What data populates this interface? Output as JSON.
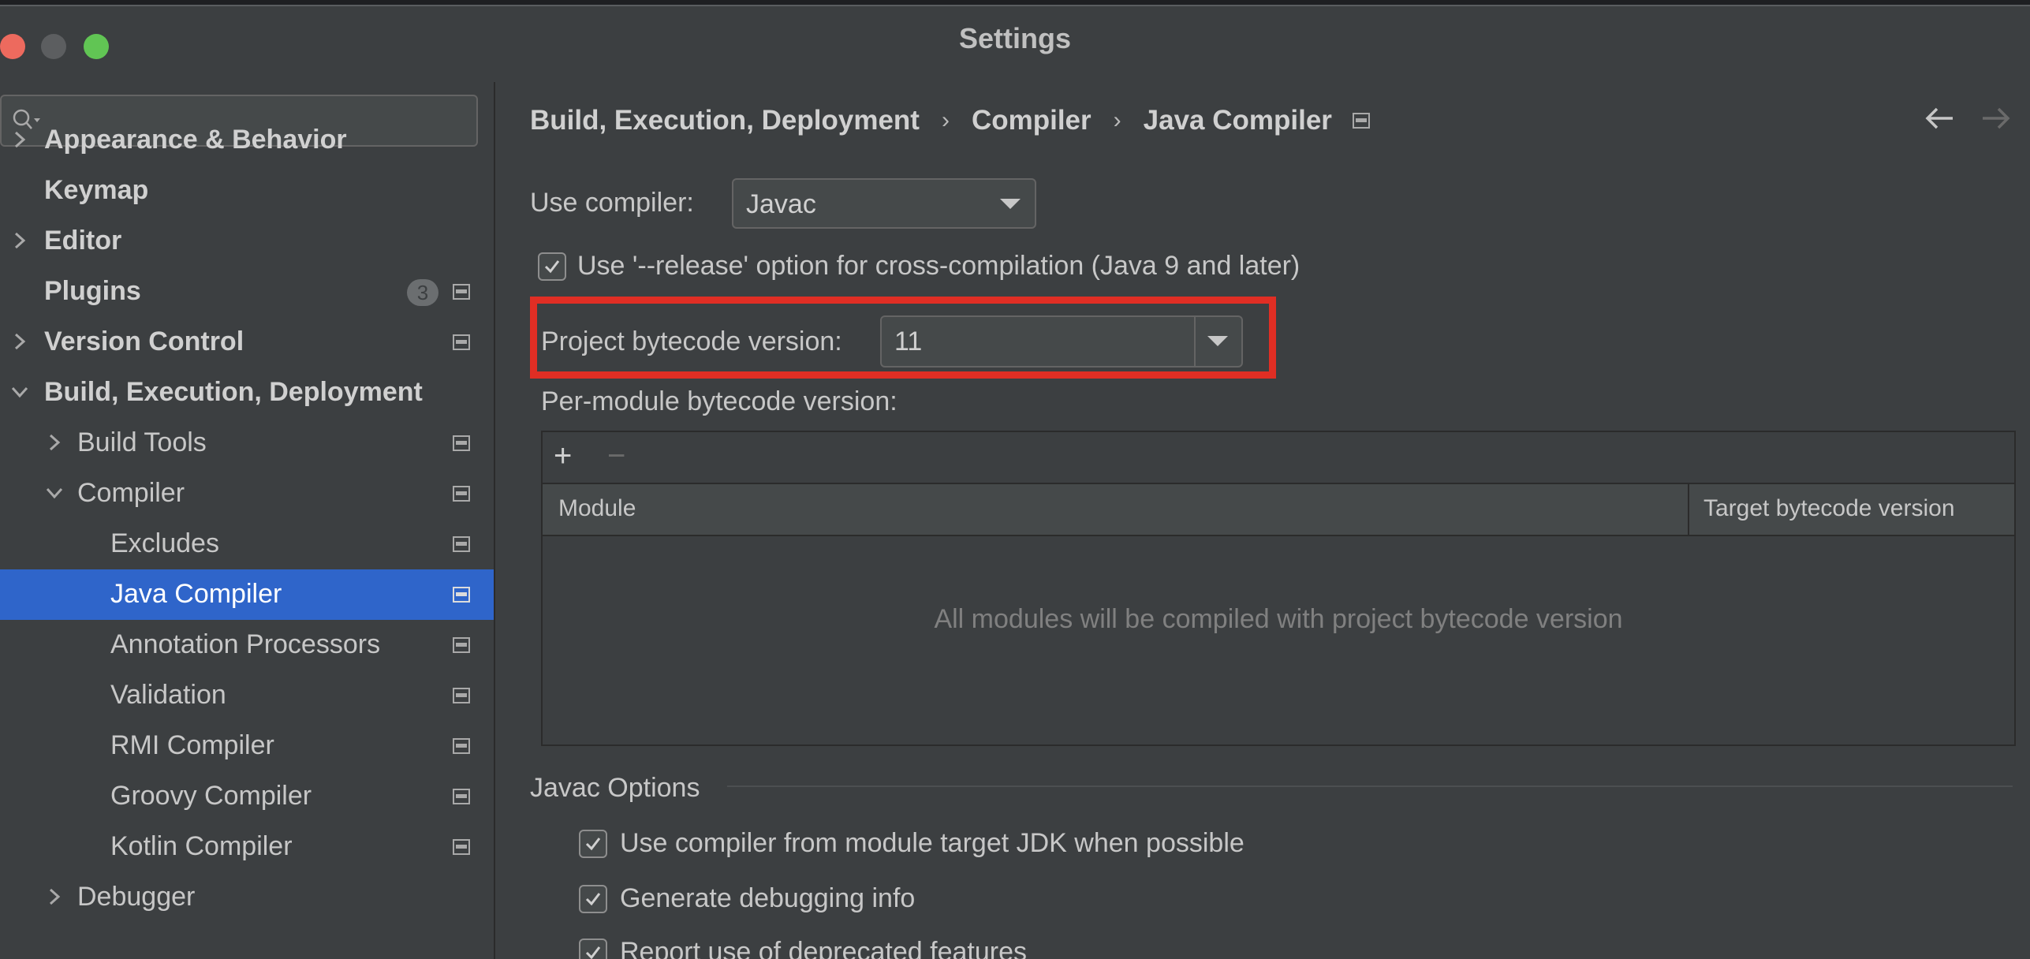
{
  "window": {
    "title": "Settings"
  },
  "search": {
    "placeholder": ""
  },
  "sidebar": {
    "items": [
      {
        "label": "Appearance & Behavior",
        "bold": true
      },
      {
        "label": "Keymap",
        "bold": true
      },
      {
        "label": "Editor",
        "bold": true
      },
      {
        "label": "Plugins",
        "bold": true,
        "badge": "3"
      },
      {
        "label": "Version Control",
        "bold": true
      },
      {
        "label": "Build, Execution, Deployment",
        "bold": true
      },
      {
        "label": "Build Tools"
      },
      {
        "label": "Compiler"
      },
      {
        "label": "Excludes"
      },
      {
        "label": "Java Compiler",
        "selected": true
      },
      {
        "label": "Annotation Processors"
      },
      {
        "label": "Validation"
      },
      {
        "label": "RMI Compiler"
      },
      {
        "label": "Groovy Compiler"
      },
      {
        "label": "Kotlin Compiler"
      },
      {
        "label": "Debugger"
      }
    ]
  },
  "breadcrumb": {
    "items": [
      "Build, Execution, Deployment",
      "Compiler",
      "Java Compiler"
    ],
    "separator": "›"
  },
  "form": {
    "use_compiler_label": "Use compiler:",
    "use_compiler_value": "Javac",
    "release_option_label": "Use '--release' option for cross-compilation (Java 9 and later)",
    "release_option_checked": true,
    "project_bytecode_label": "Project bytecode version:",
    "project_bytecode_value": "11",
    "per_module_label": "Per-module bytecode version:"
  },
  "module_table": {
    "add_label": "+",
    "remove_label": "−",
    "columns": [
      "Module",
      "Target bytecode version"
    ],
    "empty_text": "All modules will be compiled with project bytecode version"
  },
  "javac_options": {
    "section_title": "Javac Options",
    "options": [
      {
        "label": "Use compiler from module target JDK when possible",
        "checked": true
      },
      {
        "label": "Generate debugging info",
        "checked": true
      },
      {
        "label": "Report use of deprecated features",
        "checked": true
      }
    ]
  },
  "colors": {
    "background": "#3c3f41",
    "selection": "#2f65ca",
    "highlight_box": "#e02e24",
    "traffic_red": "#ed6a5e",
    "traffic_green": "#61c554"
  }
}
